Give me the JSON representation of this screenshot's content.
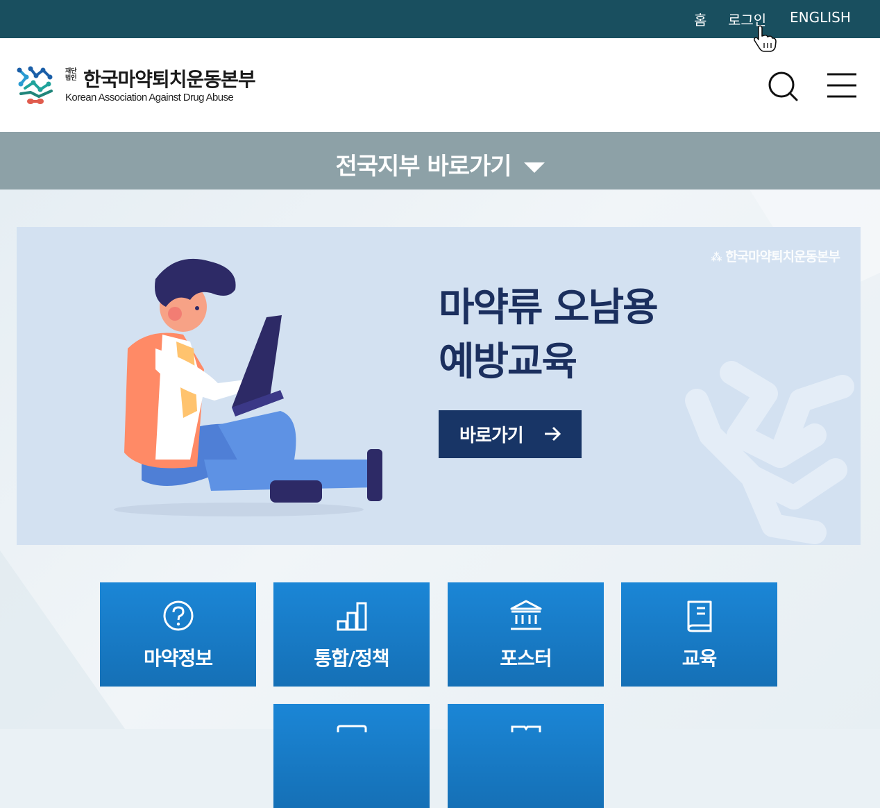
{
  "topnav": {
    "home": "홈",
    "login": "로그인",
    "english": "ENGLISH"
  },
  "logo": {
    "small": "재단법인",
    "korean": "한국마약퇴치운동본부",
    "english": "Korean Association Against Drug Abuse"
  },
  "header": {
    "search_icon": "search-icon",
    "menu_icon": "hamburger-menu-icon"
  },
  "branch": {
    "label": "전국지부 바로가기"
  },
  "banner": {
    "logo_text": "한국마약퇴치운동본부",
    "title_line1": "마약류 오남용",
    "title_line2": "예방교육",
    "button": "바로가기"
  },
  "tiles": [
    {
      "label": "마약정보",
      "icon": "question-circle-icon"
    },
    {
      "label": "통합/정책",
      "icon": "bar-chart-icon"
    },
    {
      "label": "포스터",
      "icon": "institution-icon"
    },
    {
      "label": "교육",
      "icon": "book-icon"
    }
  ],
  "colors": {
    "topbar": "#194f5f",
    "branch": "#8da1a7",
    "banner_bg": "#d3e1f1",
    "banner_text": "#1b2f5e",
    "tile": "#1a7fcc"
  }
}
